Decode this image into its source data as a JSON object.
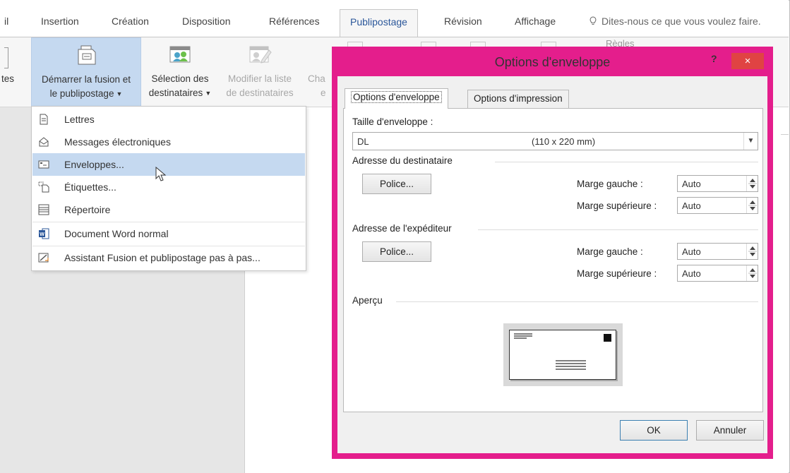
{
  "ribbon_tabs": {
    "partial_left": "il",
    "insertion": "Insertion",
    "creation": "Création",
    "disposition": "Disposition",
    "references": "Références",
    "publipostage": "Publipostage",
    "revision": "Révision",
    "affichage": "Affichage",
    "tell_me": "Dites-nous ce que vous voulez faire."
  },
  "ribbon": {
    "partial_left_label": "tes",
    "start_merge": {
      "line1": "Démarrer la fusion et",
      "line2": "le publipostage"
    },
    "select_recipients": {
      "line1": "Sélection des",
      "line2": "destinataires"
    },
    "edit_list": {
      "line1": "Modifier la liste",
      "line2": "de destinataires"
    },
    "partial_next": {
      "line1": "Cha",
      "line2": "e"
    },
    "rules_partial": "Règles"
  },
  "merge_menu": {
    "items": [
      {
        "label": "Lettres",
        "icon": "letter-icon"
      },
      {
        "label": "Messages électroniques",
        "icon": "email-icon"
      },
      {
        "label": "Enveloppes...",
        "icon": "envelope-icon",
        "highlighted": true
      },
      {
        "label": "Étiquettes...",
        "icon": "labels-icon"
      },
      {
        "label": "Répertoire",
        "icon": "directory-icon"
      },
      {
        "label": "Document Word normal",
        "icon": "word-doc-icon"
      },
      {
        "label": "Assistant Fusion et publipostage pas à pas...",
        "icon": "wizard-icon"
      }
    ]
  },
  "dialog": {
    "title": "Options d'enveloppe",
    "help": "?",
    "close": "×",
    "tabs": [
      "Options d'enveloppe",
      "Options d'impression"
    ],
    "envelope_size_label": "Taille d'enveloppe :",
    "envelope_size": {
      "name": "DL",
      "dims": "(110 x 220 mm)"
    },
    "recipient": {
      "section": "Adresse du destinataire",
      "font_button": "Police...",
      "margin_left_label": "Marge gauche :",
      "margin_left_value": "Auto",
      "margin_top_label": "Marge supérieure :",
      "margin_top_value": "Auto"
    },
    "sender": {
      "section": "Adresse de l'expéditeur",
      "font_button": "Police...",
      "margin_left_label": "Marge gauche :",
      "margin_left_value": "Auto",
      "margin_top_label": "Marge supérieure :",
      "margin_top_value": "Auto"
    },
    "preview_label": "Aperçu",
    "ok": "OK",
    "cancel": "Annuler"
  },
  "colors": {
    "dialog_border": "#e41e8c",
    "close_button": "#e04343",
    "ribbon_active_text": "#2b579a",
    "menu_highlight": "#c5d9f0"
  }
}
